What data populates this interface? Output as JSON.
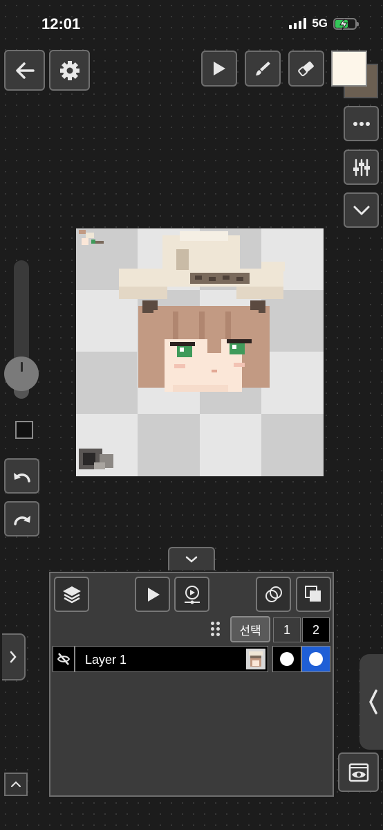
{
  "status_bar": {
    "time": "12:01",
    "network": "5G"
  },
  "toolbar": {
    "back_icon": "arrow-left-icon",
    "settings_icon": "gear-icon",
    "select_tool_icon": "pointer-icon",
    "brush_tool_icon": "brush-icon",
    "eraser_tool_icon": "eraser-icon",
    "more_icon": "ellipsis-icon",
    "adjust_icon": "sliders-icon",
    "expand_icon": "chevron-down-icon"
  },
  "colors": {
    "primary": "#fdf6ea",
    "secondary": "#6b5f52",
    "active_frame": "#1f5fd6"
  },
  "brush_size_level": 0.18,
  "layers_panel": {
    "select_label": "선택",
    "frames": [
      "1",
      "2"
    ],
    "layers": [
      {
        "name": "Layer 1"
      }
    ]
  }
}
